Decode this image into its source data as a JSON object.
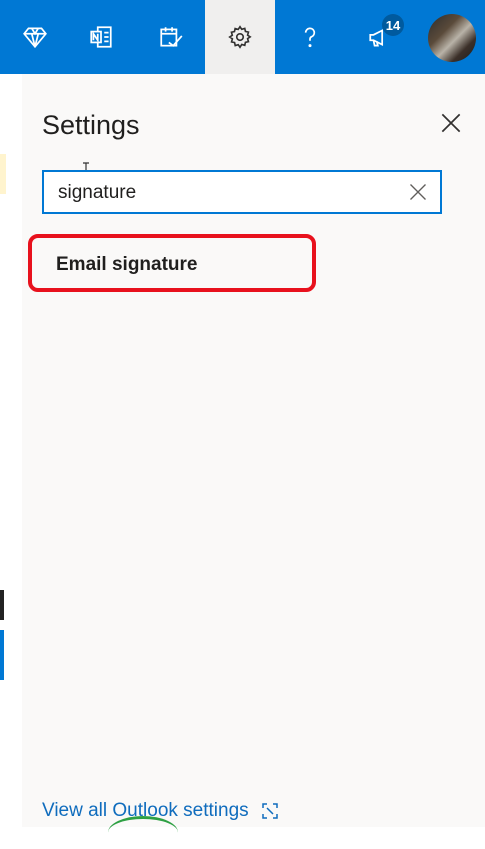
{
  "toolbar": {
    "items": [
      {
        "name": "premium",
        "icon": "diamond-icon"
      },
      {
        "name": "onenote",
        "icon": "onenote-icon"
      },
      {
        "name": "todo",
        "icon": "todo-icon"
      },
      {
        "name": "settings",
        "icon": "gear-icon"
      },
      {
        "name": "help",
        "icon": "help-icon"
      },
      {
        "name": "feedback",
        "icon": "megaphone-icon"
      }
    ],
    "notification_count": "14",
    "accent": "#0078d4"
  },
  "settings": {
    "title": "Settings",
    "search_value": "signature",
    "result_label": "Email signature",
    "view_all_label": "View all Outlook settings"
  }
}
